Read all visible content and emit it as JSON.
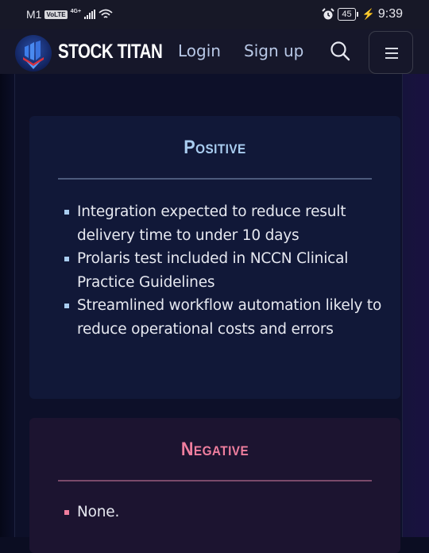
{
  "status_bar": {
    "carrier": "M1",
    "volte": "VoLTE",
    "network": "4G+",
    "battery": "45",
    "time": "9:39",
    "icons": [
      "volte-icon",
      "signal-icon",
      "wifi-icon",
      "alarm-icon",
      "battery-icon",
      "charging-icon"
    ]
  },
  "navbar": {
    "brand": "STOCK TITAN",
    "login": "Login",
    "signup": "Sign up",
    "search_icon": "search-icon",
    "menu_icon": "hamburger-menu-icon"
  },
  "positive": {
    "title": "Positive",
    "accent": "#a9cdf0",
    "items": [
      "Integration expected to reduce result delivery time to under 10 days",
      "Prolaris test included in NCCN Clinical Practice Guidelines",
      "Streamlined workflow automation likely to reduce operational costs and errors"
    ]
  },
  "negative": {
    "title": "Negative",
    "accent": "#ef7e9e",
    "items": [
      "None."
    ]
  }
}
